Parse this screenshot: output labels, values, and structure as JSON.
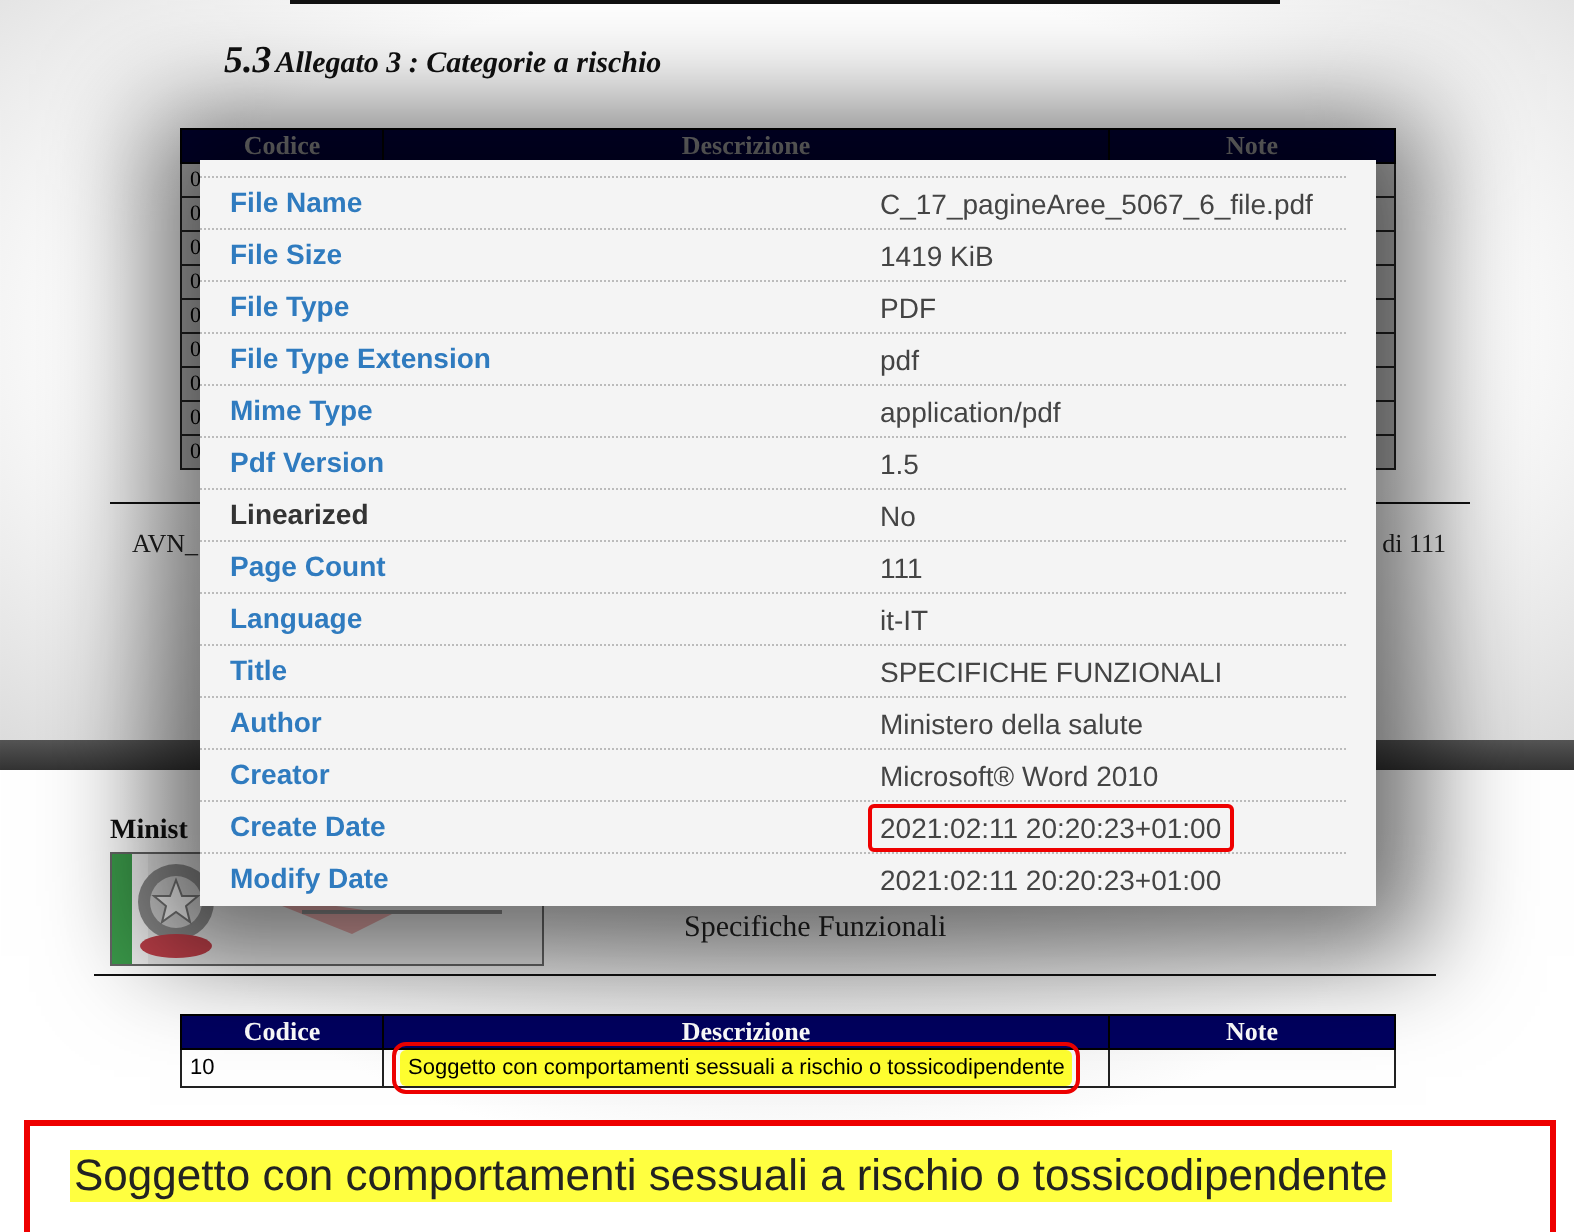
{
  "upper_page": {
    "section_number": "5.3",
    "section_title": "Allegato 3 : Categorie a rischio",
    "table": {
      "columns": [
        "Codice",
        "Descrizione",
        "Note"
      ],
      "rows": [
        {
          "code": "0"
        },
        {
          "code": "0"
        },
        {
          "code": "0"
        },
        {
          "code": "0"
        },
        {
          "code": "0"
        },
        {
          "code": "0"
        },
        {
          "code": "0"
        },
        {
          "code": "0"
        },
        {
          "code": "0"
        }
      ]
    },
    "footer_left": "AVN_",
    "footer_right": "di 111"
  },
  "lower_page": {
    "ministry": "Minist",
    "subtitle": "Specifiche Funzionali",
    "table": {
      "columns": [
        "Codice",
        "Descrizione",
        "Note"
      ],
      "rows": [
        {
          "code": "10",
          "description": "Soggetto con comportamenti sessuali a rischio o tossicodipendente",
          "highlighted": true
        }
      ]
    }
  },
  "zoom_inset": {
    "text": "Soggetto con comportamenti sessuali a rischio o tossicodipendente",
    "highlighted": true
  },
  "metadata_popup": {
    "rows": [
      {
        "label": "File Name",
        "value": "C_17_pagineAree_5067_6_file.pdf",
        "link": true,
        "marked": false
      },
      {
        "label": "File Size",
        "value": "1419 KiB",
        "link": true,
        "marked": false
      },
      {
        "label": "File Type",
        "value": "PDF",
        "link": true,
        "marked": false
      },
      {
        "label": "File Type Extension",
        "value": "pdf",
        "link": true,
        "marked": false
      },
      {
        "label": "Mime Type",
        "value": "application/pdf",
        "link": true,
        "marked": false
      },
      {
        "label": "Pdf Version",
        "value": "1.5",
        "link": true,
        "marked": false
      },
      {
        "label": "Linearized",
        "value": "No",
        "link": false,
        "marked": false
      },
      {
        "label": "Page Count",
        "value": "111",
        "link": true,
        "marked": false
      },
      {
        "label": "Language",
        "value": "it-IT",
        "link": true,
        "marked": false
      },
      {
        "label": "Title",
        "value": "SPECIFICHE FUNZIONALI",
        "link": true,
        "marked": false
      },
      {
        "label": "Author",
        "value": "Ministero della salute",
        "link": true,
        "marked": false
      },
      {
        "label": "Creator",
        "value": "Microsoft® Word 2010",
        "link": true,
        "marked": false
      },
      {
        "label": "Create Date",
        "value": "2021:02:11 20:20:23+01:00",
        "link": true,
        "marked": true
      },
      {
        "label": "Modify Date",
        "value": "2021:02:11 20:20:23+01:00",
        "link": true,
        "marked": false
      }
    ]
  }
}
